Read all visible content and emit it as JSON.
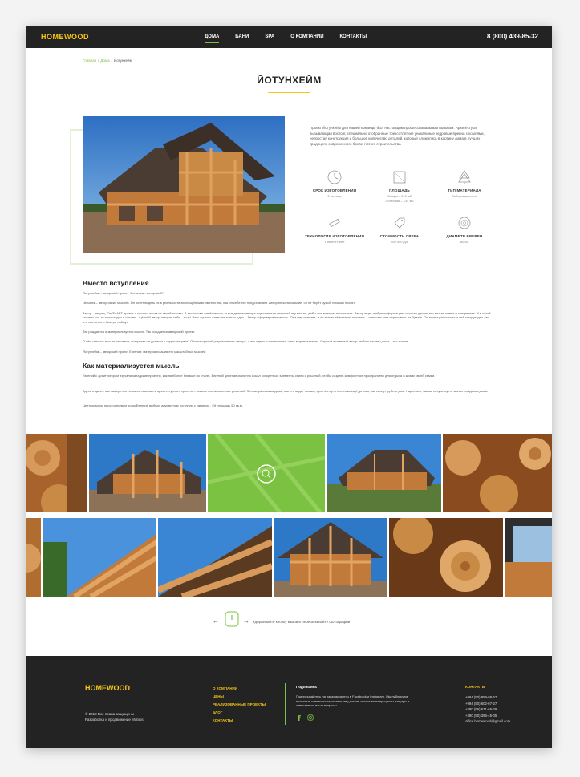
{
  "header": {
    "logo": "HOMEWOOD",
    "nav": [
      "ДОМА",
      "БАНИ",
      "SPA",
      "О КОМПАНИИ",
      "КОНТАКТЫ"
    ],
    "active_nav": "ДОМА",
    "phone": "8 (800) 439-85-32"
  },
  "breadcrumb": [
    "Главная",
    "Дома",
    "Йотунхейм"
  ],
  "page_title": "ЙОТУНХЕЙМ",
  "intro_text": "Проект Йотунхейм для нашей команды был настоящим профессиональным вызовом. Архитектура, вызывающая восторг, специально отобранные трехсотлетние уникальные кедровые бревна с комлями, непростая конструкция и большое количество деталей, которые сложились в картину дома в лучших традициях современного бревенчатого строительства",
  "specs": [
    {
      "label": "СРОК ИЗГОТОВЛЕНИЯ",
      "value": "2 месяца",
      "icon": "clock-icon"
    },
    {
      "label": "ПЛОЩАДЬ",
      "value": "Общая – 212 м2\nПолезная – 134 м2",
      "icon": "area-icon"
    },
    {
      "label": "ТИП МАТЕРИАЛА",
      "value": "Сибирская сосна",
      "icon": "tree-icon"
    },
    {
      "label": "ТЕХНОЛОГИЯ ИЗГОТОВЛЕНИЯ",
      "value": "Timber Frame",
      "icon": "saw-icon"
    },
    {
      "label": "СТОИМОСТЬ СРУБА",
      "value": "200 000 руб",
      "icon": "price-tag-icon"
    },
    {
      "label": "ДИАМЕТР БРЕВЕН",
      "value": "80 см",
      "icon": "log-icon"
    }
  ],
  "section1": {
    "heading": "Вместо вступления",
    "paragraphs": [
      "Йотунхейм – авторский проект. Что значит авторский?",
      "Человек – автор своих мыслей. Он хочет видеть их в реальности воплощёнными именно так, как он себе это представляет. Автор не копирование, он не берёт чужой готовый проект.",
      "Автор – творец. Он ЗНАЕТ проект с чистого листа из своей головы. В его голове живёт мысль, и все деяния автора подчиняются энергией эту мысль, дабы она материализовалась. Автор ищет любую информацию, которая делает его мысль живее и конкретнее. И в какой момент что-то происходит в голове – щёлк! И автор говорит себе – есть! Этот щелчок означает только одно – Автор сформировал мысль. Она ему понятна, и он может её материализовать – написать или нарисовать на бумаге. Он может рассказать о ней кому угодно так, что его легко и быстро поймут.",
      "Так рождается и материализуется мысль. Так рождается авторский проект.",
      "О чём говорит мысли человека, которыми он делится с окружающими? Они говорят об устремлениях автора, о его идеях и начинаниях, о его мировоззрении. Первый и главный автор любого нашего дома – его хозяин.",
      "Йотунхейм – авторский проект Евгения: материализация его масштабных мыслей"
    ]
  },
  "section2": {
    "heading": "Как материализуется мысль",
    "paragraphs": [
      "Евгений с архитектором изучали канадские проекты, как наиболее близкие по стилю. Евгений целенаправленно искал конкретные элементы стиля и решений, чтобы создать комфортное пространство для отдыха и жизни своей семьи.",
      "Здесь и далее мы намеренно покажем вам части архитектурного проекта – эскизы планировочных решений. Это визуализация дома, как его видят хозяин, архитектор и плотники ещё до того, как начнут рубить дом. Надеемся, так вы почувствуете магию рождения дома.",
      "Центральным пространством дома Евгений выбрал двусветную гостиную с камином . Её площадь 50 кв.м."
    ]
  },
  "gallery_hint": "Удерживайте кнопку мыши и перетаскивайте фотографии",
  "footer": {
    "logo": "HOMEWOOD",
    "copyright": "© 2018 Все права защищены",
    "developer": "Разработка и продвижение Mobios",
    "links": [
      "О КОМПАНИИ",
      "ЦЕНЫ",
      "РЕАЛИЗОВАННЫЕ ПРОЕКТЫ",
      "БЛОГ",
      "КОНТАКТЫ"
    ],
    "subscribe_title": "Подпишись",
    "subscribe_text": "Подписывайтесь на наши аккаунты в Facebook и Instagram. Мы публикуем полезные советы по строительству домов, показываем процессы изнутри и отвечаем на ваши вопросы.",
    "contacts_title": "КОНТАКТЫ",
    "contacts": [
      "+994 (50) 859-98-67",
      "+994 (50) 602-07-27",
      "+380 (66) 671-66-29",
      "+380 (50) 395-45-05",
      "office.homewood@gmail.com"
    ]
  },
  "colors": {
    "accent": "#7cc242",
    "brand": "#f5c518",
    "dark": "#232323"
  }
}
